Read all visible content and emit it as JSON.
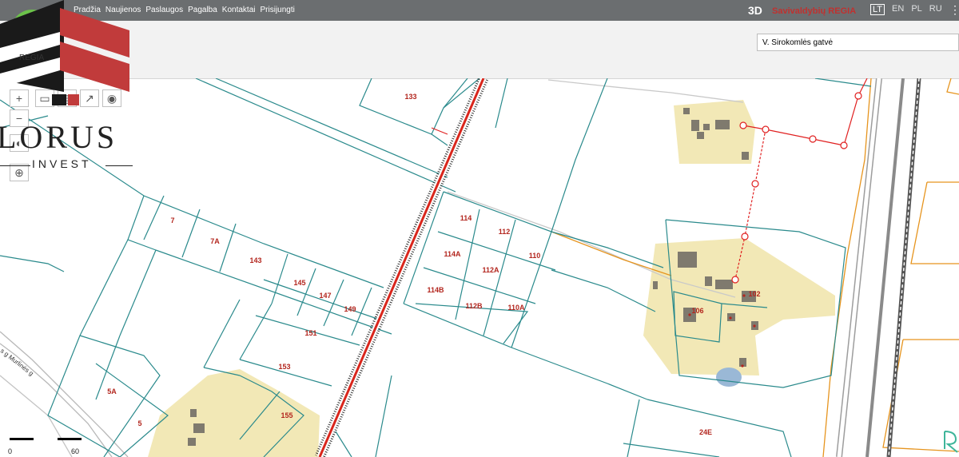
{
  "nav": {
    "items": [
      "Pradžia",
      "Naujienos",
      "Paslaugos",
      "Pagalba",
      "Kontaktai",
      "Prisijungti"
    ]
  },
  "header": {
    "mode_3d": "3D",
    "brand": "Savivaldybių REGIA"
  },
  "languages": [
    {
      "code": "LT",
      "active": true
    },
    {
      "code": "EN"
    },
    {
      "code": "PL"
    },
    {
      "code": "RU"
    }
  ],
  "search": {
    "value": "V. Sirokomlės gatvė"
  },
  "logo": {
    "text_main": "LORUS",
    "text_sub": "INVEST",
    "regia_label": "REGIA"
  },
  "map": {
    "plots": [
      "133",
      "7",
      "7A",
      "143",
      "145",
      "147",
      "149",
      "151",
      "153",
      "155",
      "5A",
      "5",
      "114",
      "112",
      "114A",
      "112A",
      "110",
      "114B",
      "112B",
      "110A",
      "106",
      "102",
      "24E"
    ],
    "street_label": "s g Murlinės g"
  },
  "scale": {
    "start": "0",
    "end": "60 m"
  },
  "colors": {
    "parcel": "#2a8a8c",
    "railway": "#d9261c",
    "building_area": "#f2e8b6",
    "utility_line": "#e02020",
    "top_bar": "#6b6e70"
  }
}
